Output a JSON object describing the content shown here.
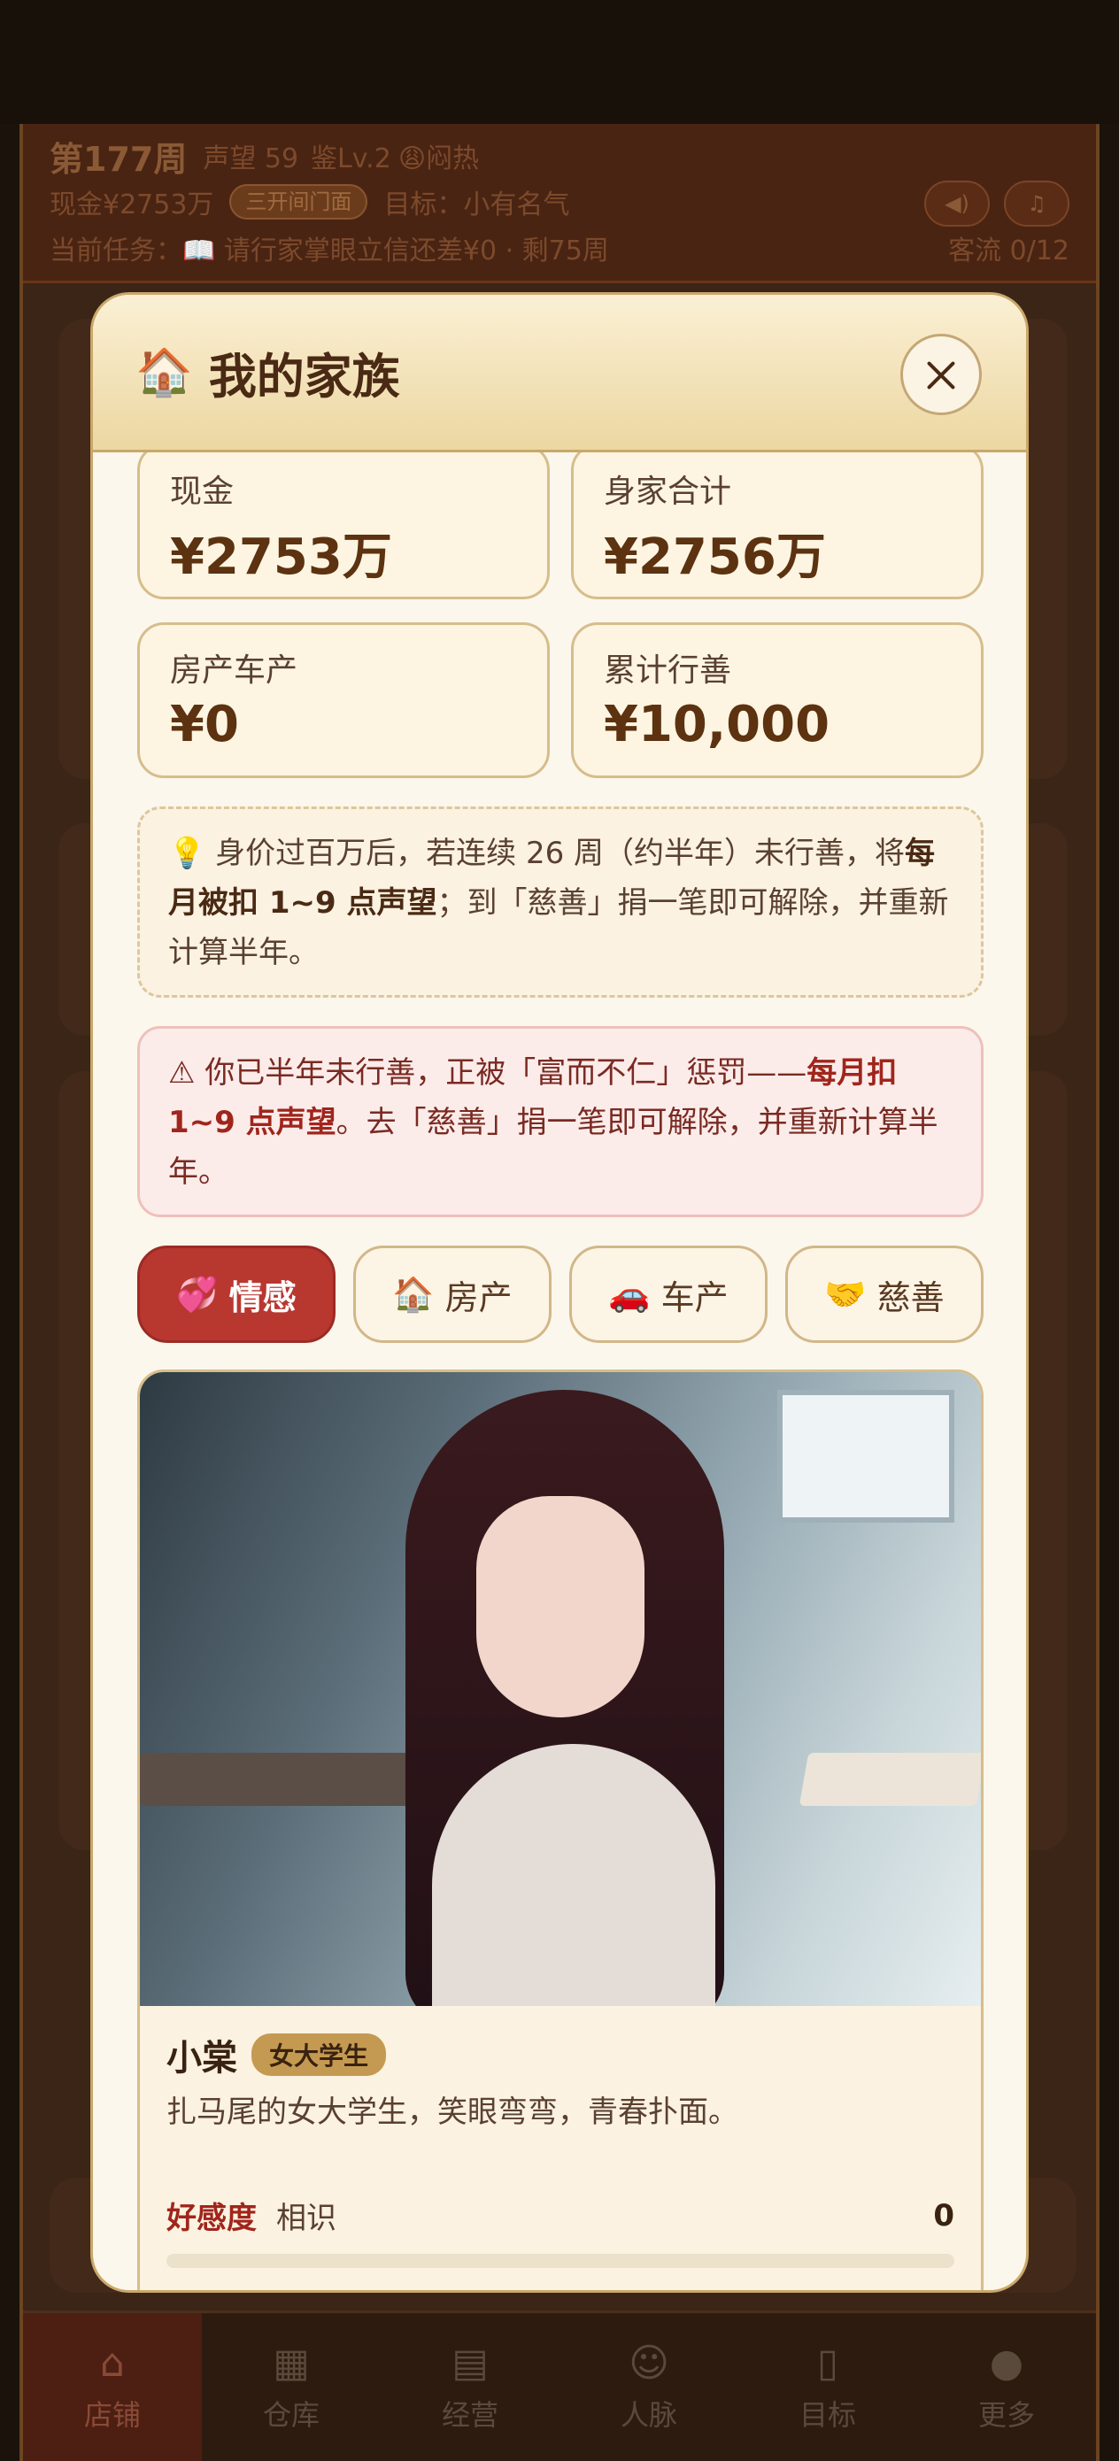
{
  "hud": {
    "week": "第177周",
    "reputation": "声望 59",
    "appraisal_level": "鉴Lv.2",
    "weather": "😩闷热",
    "cash": "现金¥2753万",
    "expand_button": "三开间门面",
    "goal": "目标：小有名气",
    "task": "当前任务：📖 请行家掌眼立信还差¥0 · 剩75周",
    "visitors": "客流 0/12",
    "sound_icon": "speaker-icon",
    "music_icon": "music-note-icon"
  },
  "modal": {
    "icon": "house-icon",
    "title": "我的家族",
    "stats": [
      {
        "label": "现金",
        "value": "¥2753万"
      },
      {
        "label": "身家合计",
        "value": "¥2756万"
      },
      {
        "label": "房产车产",
        "value": "¥0"
      },
      {
        "label": "累计行善",
        "value": "¥10,000"
      }
    ],
    "tip": {
      "prefix": "💡 身价过百万后，若连续 26 周（约半年）未行善，将",
      "bold": "每月被扣 1~9 点声望",
      "suffix": "；到「慈善」捐一笔即可解除，并重新计算半年。"
    },
    "warning": {
      "prefix": "⚠ 你已半年未行善，正被「富而不仁」惩罚——",
      "bold": "每月扣 1~9 点声望",
      "suffix": "。去「慈善」捐一笔即可解除，并重新计算半年。"
    },
    "tabs": [
      {
        "icon": "💞",
        "label": "情感",
        "active": true
      },
      {
        "icon": "🏠",
        "label": "房产",
        "active": false
      },
      {
        "icon": "🚗",
        "label": "车产",
        "active": false
      },
      {
        "icon": "🤝",
        "label": "慈善",
        "active": false
      }
    ],
    "profile": {
      "name": "小棠",
      "tag": "女大学生",
      "description": "扎马尾的女大学生，笑眼弯弯，青春扑面。",
      "affection_label": "好感度",
      "affection_stage": "相识",
      "affection_value": "0",
      "affection_progress": 0
    }
  },
  "bottom_nav": [
    {
      "icon": "shop-icon",
      "label": "店铺",
      "active": true
    },
    {
      "icon": "warehouse-icon",
      "label": "仓库",
      "active": false
    },
    {
      "icon": "ledger-icon",
      "label": "经营",
      "active": false
    },
    {
      "icon": "people-icon",
      "label": "人脉",
      "active": false
    },
    {
      "icon": "target-icon",
      "label": "目标",
      "active": false
    },
    {
      "icon": "more-icon",
      "label": "更多",
      "active": false
    }
  ]
}
